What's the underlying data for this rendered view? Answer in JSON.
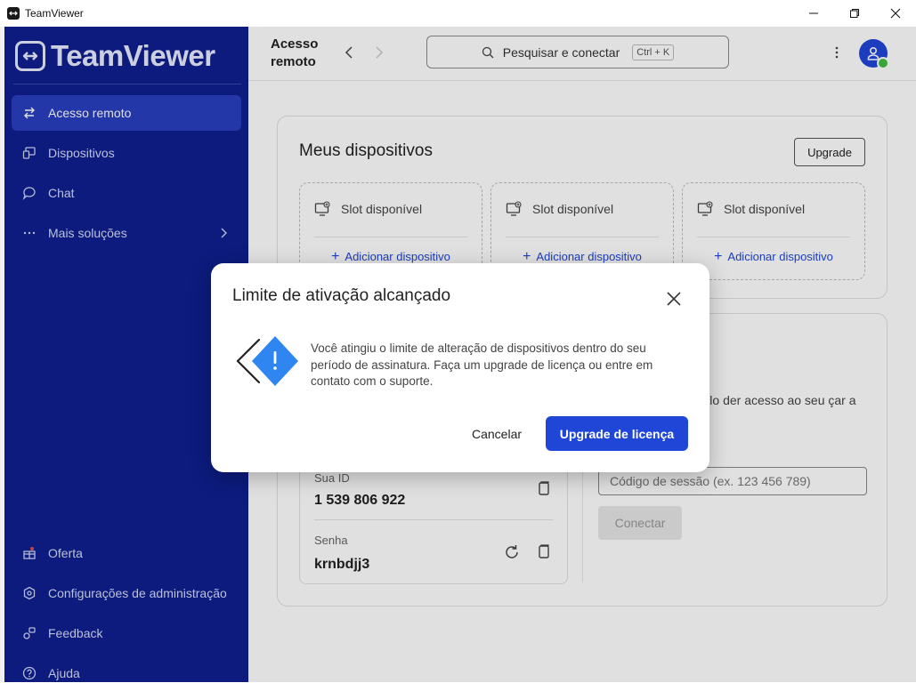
{
  "window": {
    "title": "TeamViewer"
  },
  "sidebar": {
    "logo_text": "TeamViewer",
    "items": [
      {
        "label": "Acesso remoto",
        "icon": "arrows-swap-icon",
        "active": true
      },
      {
        "label": "Dispositivos",
        "icon": "devices-icon"
      },
      {
        "label": "Chat",
        "icon": "chat-icon"
      },
      {
        "label": "Mais soluções",
        "icon": "more-dots-icon"
      }
    ],
    "bottom_items": [
      {
        "label": "Oferta",
        "icon": "gift-icon"
      },
      {
        "label": "Configurações de administração",
        "icon": "admin-settings-icon"
      },
      {
        "label": "Feedback",
        "icon": "feedback-icon"
      },
      {
        "label": "Ajuda",
        "icon": "help-icon"
      }
    ]
  },
  "header": {
    "title": "Acesso remoto",
    "search_placeholder": "Pesquisar e conectar",
    "search_shortcut": "Ctrl + K"
  },
  "devices": {
    "title": "Meus dispositivos",
    "upgrade_label": "Upgrade",
    "slots": [
      {
        "label": "Slot disponível",
        "add_label": "Adicionar dispositivo"
      },
      {
        "label": "Slot disponível",
        "add_label": "Adicionar dispositivo"
      },
      {
        "label": "Slot disponível",
        "add_label": "Adicionar dispositivo"
      }
    ]
  },
  "remote": {
    "session_text": "sessão fornecido pelo der acesso ao seu çar a receber suporte.",
    "session_placeholder": "Código de sessão (ex. 123 456 789)",
    "connect_label": "Conectar",
    "id_label": "Sua ID",
    "id_value": "1 539 806 922",
    "password_label": "Senha",
    "password_value": "krnbdjj3"
  },
  "dialog": {
    "title": "Limite de ativação alcançado",
    "message": "Você atingiu o limite de alteração de dispositivos dentro do seu período de assinatura. Faça um upgrade de licença ou entre em contato com o suporte.",
    "cancel_label": "Cancelar",
    "primary_label": "Upgrade de licença"
  },
  "colors": {
    "sidebar_bg": "#0e1f8f",
    "accent": "#2046d8",
    "active_item": "#2a3fc0"
  }
}
